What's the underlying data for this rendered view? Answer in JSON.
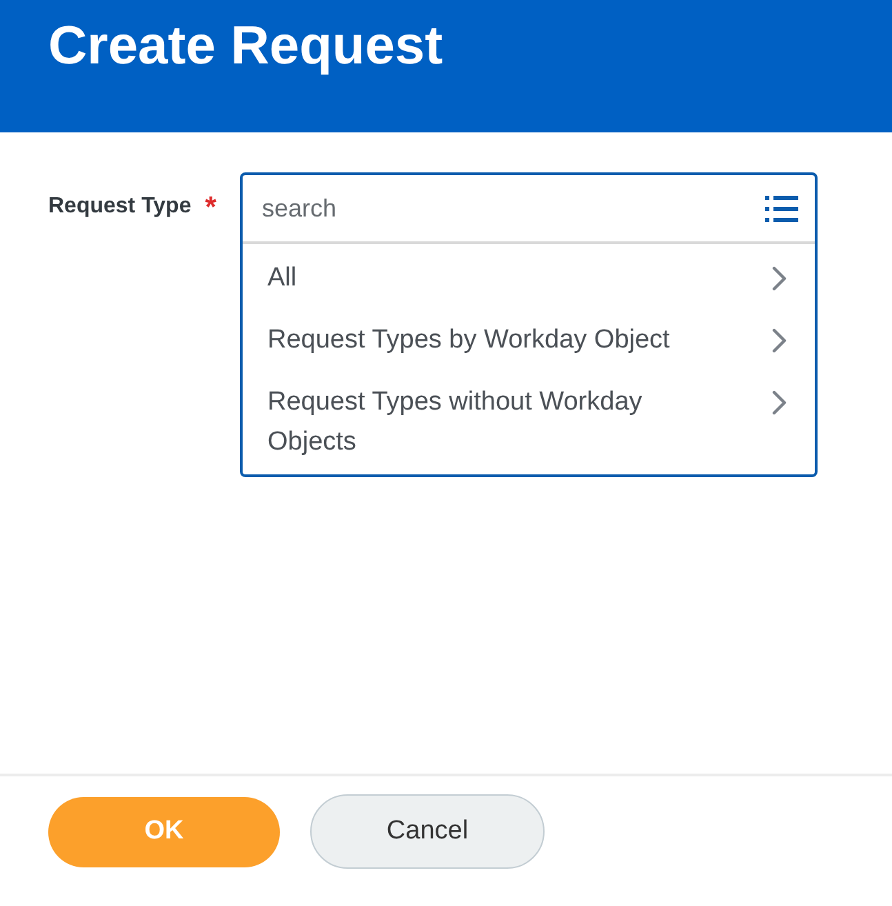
{
  "header": {
    "title": "Create Request"
  },
  "form": {
    "label": "Request Type",
    "required_mark": "*",
    "placeholder": "search",
    "expanded": true,
    "options": [
      {
        "label": "All"
      },
      {
        "label": "Request Types by Workday Object"
      },
      {
        "label": "Request Types without Workday Objects"
      }
    ]
  },
  "buttons": [
    {
      "label": "OK",
      "kind": "primary"
    },
    {
      "label": "Cancel",
      "kind": "secondary"
    }
  ]
}
